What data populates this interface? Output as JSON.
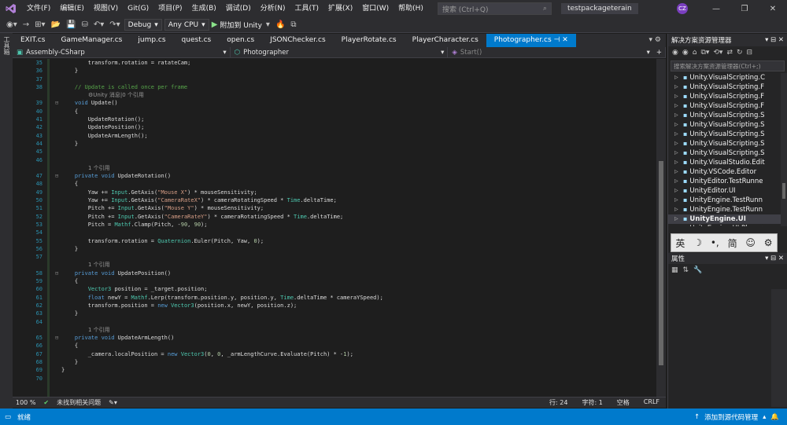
{
  "menu": [
    "文件(F)",
    "编辑(E)",
    "视图(V)",
    "Git(G)",
    "项目(P)",
    "生成(B)",
    "调试(D)",
    "分析(N)",
    "工具(T)",
    "扩展(X)",
    "窗口(W)",
    "帮助(H)"
  ],
  "search": {
    "placeholder": "搜索 (Ctrl+Q)"
  },
  "project_name": "testpackageterain",
  "user_initials": "CZ",
  "toolbar": {
    "config": "Debug",
    "platform": "Any CPU",
    "attach": "附加到 Unity"
  },
  "left_strip": "工具箱",
  "tabs": [
    "EXIT.cs",
    "GameManager.cs",
    "jump.cs",
    "quest.cs",
    "open.cs",
    "JSONChecker.cs",
    "PlayerRotate.cs",
    "PlayerCharacter.cs",
    "Photographer.cs"
  ],
  "active_tab_index": 8,
  "nav": {
    "project": "Assembly-CSharp",
    "class": "Photographer",
    "member": "Start()"
  },
  "code_lines": [
    {
      "n": "35",
      "t": "        transform.rotation = ratateCam;"
    },
    {
      "n": "36",
      "t": "    }"
    },
    {
      "n": "37",
      "t": ""
    },
    {
      "n": "38",
      "t": "    // Update is called once per frame",
      "c": "cm"
    },
    {
      "n": "",
      "lens": "⚙Unity 消息|0 个引用"
    },
    {
      "n": "39",
      "t": "    void Update()"
    },
    {
      "n": "40",
      "t": "    {"
    },
    {
      "n": "41",
      "t": "        UpdateRotation();"
    },
    {
      "n": "42",
      "t": "        UpdatePosition();"
    },
    {
      "n": "43",
      "t": "        UpdateArmLength();"
    },
    {
      "n": "44",
      "t": "    }"
    },
    {
      "n": "45",
      "t": ""
    },
    {
      "n": "46",
      "t": ""
    },
    {
      "n": "",
      "lens": "1 个引用"
    },
    {
      "n": "47",
      "t": "    private void UpdateRotation()"
    },
    {
      "n": "48",
      "t": "    {"
    },
    {
      "n": "49",
      "t": "        Yaw += Input.GetAxis(\"Mouse X\") * mouseSensitivity;"
    },
    {
      "n": "50",
      "t": "        Yaw += Input.GetAxis(\"CameraRateX\") * cameraRotatingSpeed * Time.deltaTime;"
    },
    {
      "n": "51",
      "t": "        Pitch += Input.GetAxis(\"Mouse Y\") * mouseSensitivity;"
    },
    {
      "n": "52",
      "t": "        Pitch += Input.GetAxis(\"CameraRateY\") * cameraRotatingSpeed * Time.deltaTime;"
    },
    {
      "n": "53",
      "t": "        Pitch = Mathf.Clamp(Pitch, -90, 90);"
    },
    {
      "n": "54",
      "t": ""
    },
    {
      "n": "55",
      "t": "        transform.rotation = Quaternion.Euler(Pitch, Yaw, 0);"
    },
    {
      "n": "56",
      "t": "    }"
    },
    {
      "n": "57",
      "t": ""
    },
    {
      "n": "",
      "lens": "1 个引用"
    },
    {
      "n": "58",
      "t": "    private void UpdatePosition()"
    },
    {
      "n": "59",
      "t": "    {"
    },
    {
      "n": "60",
      "t": "        Vector3 position = _target.position;"
    },
    {
      "n": "61",
      "t": "        float newY = Mathf.Lerp(transform.position.y, position.y, Time.deltaTime * cameraYSpeed);"
    },
    {
      "n": "62",
      "t": "        transform.position = new Vector3(position.x, newY, position.z);"
    },
    {
      "n": "63",
      "t": "    }"
    },
    {
      "n": "64",
      "t": ""
    },
    {
      "n": "",
      "lens": "1 个引用"
    },
    {
      "n": "65",
      "t": "    private void UpdateArmLength()"
    },
    {
      "n": "66",
      "t": "    {"
    },
    {
      "n": "67",
      "t": "        _camera.localPosition = new Vector3(0, 0, _armLengthCurve.Evaluate(Pitch) * -1);"
    },
    {
      "n": "68",
      "t": "    }"
    },
    {
      "n": "69",
      "t": "}"
    },
    {
      "n": "70",
      "t": ""
    }
  ],
  "editor_status": {
    "zoom": "100 %",
    "issues": "未找到相关问题",
    "line": "行: 24",
    "char": "字符: 1",
    "ws": "空格",
    "eol": "CRLF"
  },
  "solution_explorer": {
    "title": "解决方案资源管理器",
    "search_placeholder": "搜索解决方案资源管理器(Ctrl+;)",
    "items": [
      "Unity.VisualScripting.C",
      "Unity.VisualScripting.F",
      "Unity.VisualScripting.F",
      "Unity.VisualScripting.F",
      "Unity.VisualScripting.S",
      "Unity.VisualScripting.S",
      "Unity.VisualScripting.S",
      "Unity.VisualScripting.S",
      "Unity.VisualScripting.S",
      "Unity.VisualStudio.Edit",
      "Unity.VSCode.Editor",
      "UnityEditor.TestRunne",
      "UnityEditor.UI",
      "UnityEngine.TestRunn",
      "UnityEngine.TestRunn",
      "UnityEngine.UI",
      "UnityEngine.UI.Player"
    ],
    "selected_index": 15
  },
  "ime": [
    "英",
    "☽",
    "•,",
    "简",
    "☺",
    "⚙"
  ],
  "properties": {
    "title": "属性"
  },
  "statusbar": {
    "ready": "就绪",
    "source_control": "添加到源代码管理"
  }
}
